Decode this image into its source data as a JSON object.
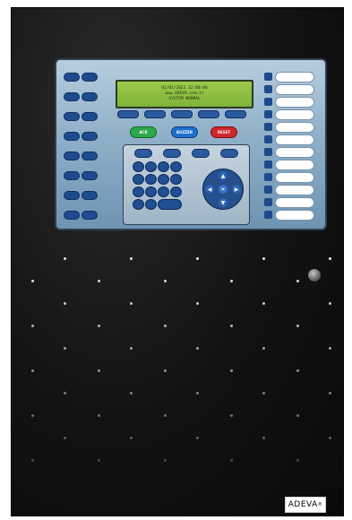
{
  "lcd": {
    "line1": "01/01/2021 12:00:00",
    "line2": "www.ADEVA.com.tr",
    "line3": "SYSTEM NORMAL"
  },
  "controls": {
    "ack": "ACK",
    "buzzer": "BUZZER",
    "reset": "RESET"
  },
  "colors": {
    "ack": "#2aa84a",
    "buzzer": "#1f6fd0",
    "reset": "#d0262b"
  },
  "brand": {
    "logo": "ADEVA",
    "registered": "®"
  }
}
